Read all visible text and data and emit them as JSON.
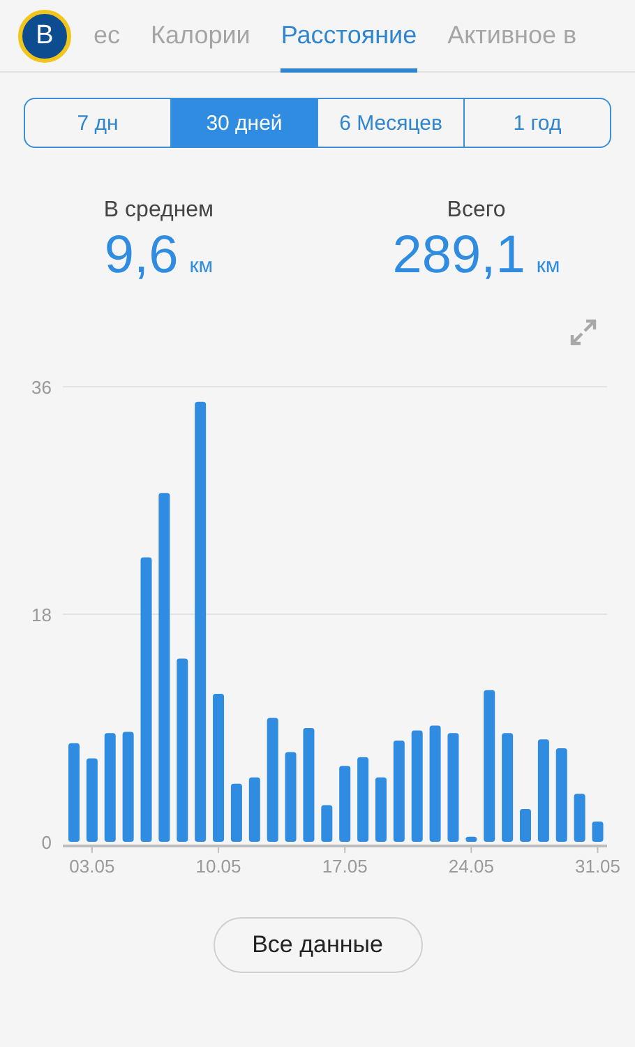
{
  "avatar": {
    "letter": "В"
  },
  "tabs": [
    {
      "label": "ес",
      "selected": false
    },
    {
      "label": "Калории",
      "selected": false
    },
    {
      "label": "Расстояние",
      "selected": true
    },
    {
      "label": "Активное в",
      "selected": false
    }
  ],
  "periods": [
    {
      "label": "7 дн",
      "selected": false
    },
    {
      "label": "30 дней",
      "selected": true
    },
    {
      "label": "6 Месяцев",
      "selected": false
    },
    {
      "label": "1 год",
      "selected": false
    }
  ],
  "stats": [
    {
      "label": "В среднем",
      "value": "9,6",
      "unit": "км"
    },
    {
      "label": "Всего",
      "value": "289,1",
      "unit": "км"
    }
  ],
  "chart_data": {
    "type": "bar",
    "ylim": [
      0,
      36
    ],
    "yticks": [
      0,
      18,
      36
    ],
    "categories": [
      null,
      "03.05",
      null,
      null,
      null,
      null,
      null,
      null,
      "10.05",
      null,
      null,
      null,
      null,
      null,
      null,
      "17.05",
      null,
      null,
      null,
      null,
      null,
      null,
      "24.05",
      null,
      null,
      null,
      null,
      null,
      null,
      "31.05"
    ],
    "values": [
      7.8,
      6.6,
      8.6,
      8.7,
      22.5,
      27.6,
      14.5,
      34.8,
      11.7,
      4.6,
      5.1,
      9.8,
      7.1,
      9.0,
      2.9,
      6.0,
      6.7,
      5.1,
      8.0,
      8.8,
      9.2,
      8.6,
      0.4,
      12.0,
      8.6,
      2.6,
      8.1,
      7.4,
      3.8,
      1.6
    ]
  },
  "all_data_button": "Все данные"
}
